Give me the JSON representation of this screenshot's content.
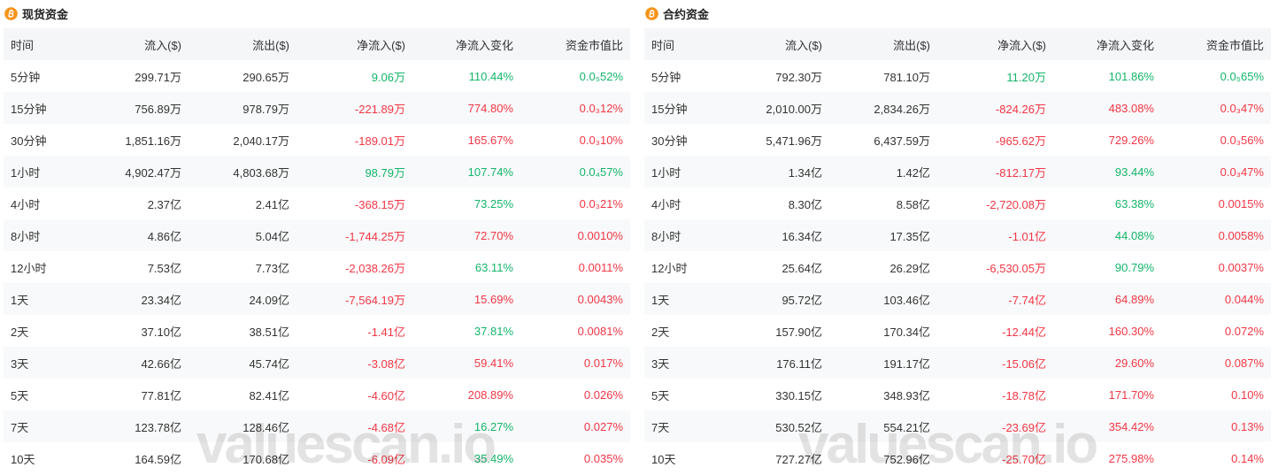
{
  "colors": {
    "green": "#14b56a",
    "red": "#f23645",
    "text": "#333333",
    "title": "#222222",
    "header_bg": "#f5f6f8",
    "stripe_bg": "#f8f9fa",
    "bitcoin": "#f7931a"
  },
  "panels": [
    {
      "title": "现货资金",
      "icon": "bitcoin-icon",
      "watermark": "valuescan.io",
      "columns": [
        "时间",
        "流入($)",
        "流出($)",
        "净流入($)",
        "净流入变化",
        "资金市值比"
      ],
      "rows": [
        {
          "time": "5分钟",
          "inflow": "299.71万",
          "outflow": "290.65万",
          "net": "9.06万",
          "change": "110.44%",
          "ratio": "0.0₅52%",
          "net_color": "green",
          "change_color": "green",
          "ratio_color": "green"
        },
        {
          "time": "15分钟",
          "inflow": "756.89万",
          "outflow": "978.79万",
          "net": "-221.89万",
          "change": "774.80%",
          "ratio": "0.0₃12%",
          "net_color": "red",
          "change_color": "red",
          "ratio_color": "red"
        },
        {
          "time": "30分钟",
          "inflow": "1,851.16万",
          "outflow": "2,040.17万",
          "net": "-189.01万",
          "change": "165.67%",
          "ratio": "0.0₃10%",
          "net_color": "red",
          "change_color": "red",
          "ratio_color": "red"
        },
        {
          "time": "1小时",
          "inflow": "4,902.47万",
          "outflow": "4,803.68万",
          "net": "98.79万",
          "change": "107.74%",
          "ratio": "0.0₄57%",
          "net_color": "green",
          "change_color": "green",
          "ratio_color": "green"
        },
        {
          "time": "4小时",
          "inflow": "2.37亿",
          "outflow": "2.41亿",
          "net": "-368.15万",
          "change": "73.25%",
          "ratio": "0.0₃21%",
          "net_color": "red",
          "change_color": "green",
          "ratio_color": "red"
        },
        {
          "time": "8小时",
          "inflow": "4.86亿",
          "outflow": "5.04亿",
          "net": "-1,744.25万",
          "change": "72.70%",
          "ratio": "0.0010%",
          "net_color": "red",
          "change_color": "red",
          "ratio_color": "red"
        },
        {
          "time": "12小时",
          "inflow": "7.53亿",
          "outflow": "7.73亿",
          "net": "-2,038.26万",
          "change": "63.11%",
          "ratio": "0.0011%",
          "net_color": "red",
          "change_color": "green",
          "ratio_color": "red"
        },
        {
          "time": "1天",
          "inflow": "23.34亿",
          "outflow": "24.09亿",
          "net": "-7,564.19万",
          "change": "15.69%",
          "ratio": "0.0043%",
          "net_color": "red",
          "change_color": "red",
          "ratio_color": "red"
        },
        {
          "time": "2天",
          "inflow": "37.10亿",
          "outflow": "38.51亿",
          "net": "-1.41亿",
          "change": "37.81%",
          "ratio": "0.0081%",
          "net_color": "red",
          "change_color": "green",
          "ratio_color": "red"
        },
        {
          "time": "3天",
          "inflow": "42.66亿",
          "outflow": "45.74亿",
          "net": "-3.08亿",
          "change": "59.41%",
          "ratio": "0.017%",
          "net_color": "red",
          "change_color": "red",
          "ratio_color": "red"
        },
        {
          "time": "5天",
          "inflow": "77.81亿",
          "outflow": "82.41亿",
          "net": "-4.60亿",
          "change": "208.89%",
          "ratio": "0.026%",
          "net_color": "red",
          "change_color": "red",
          "ratio_color": "red"
        },
        {
          "time": "7天",
          "inflow": "123.78亿",
          "outflow": "128.46亿",
          "net": "-4.68亿",
          "change": "16.27%",
          "ratio": "0.027%",
          "net_color": "red",
          "change_color": "green",
          "ratio_color": "red"
        },
        {
          "time": "10天",
          "inflow": "164.59亿",
          "outflow": "170.68亿",
          "net": "-6.09亿",
          "change": "35.49%",
          "ratio": "0.035%",
          "net_color": "red",
          "change_color": "green",
          "ratio_color": "red"
        }
      ]
    },
    {
      "title": "合约资金",
      "icon": "bitcoin-icon",
      "watermark": "valuescan.io",
      "columns": [
        "时间",
        "流入($)",
        "流出($)",
        "净流入($)",
        "净流入变化",
        "资金市值比"
      ],
      "rows": [
        {
          "time": "5分钟",
          "inflow": "792.30万",
          "outflow": "781.10万",
          "net": "11.20万",
          "change": "101.86%",
          "ratio": "0.0₅65%",
          "net_color": "green",
          "change_color": "green",
          "ratio_color": "green"
        },
        {
          "time": "15分钟",
          "inflow": "2,010.00万",
          "outflow": "2,834.26万",
          "net": "-824.26万",
          "change": "483.08%",
          "ratio": "0.0₃47%",
          "net_color": "red",
          "change_color": "red",
          "ratio_color": "red"
        },
        {
          "time": "30分钟",
          "inflow": "5,471.96万",
          "outflow": "6,437.59万",
          "net": "-965.62万",
          "change": "729.26%",
          "ratio": "0.0₃56%",
          "net_color": "red",
          "change_color": "red",
          "ratio_color": "red"
        },
        {
          "time": "1小时",
          "inflow": "1.34亿",
          "outflow": "1.42亿",
          "net": "-812.17万",
          "change": "93.44%",
          "ratio": "0.0₃47%",
          "net_color": "red",
          "change_color": "green",
          "ratio_color": "red"
        },
        {
          "time": "4小时",
          "inflow": "8.30亿",
          "outflow": "8.58亿",
          "net": "-2,720.08万",
          "change": "63.38%",
          "ratio": "0.0015%",
          "net_color": "red",
          "change_color": "green",
          "ratio_color": "red"
        },
        {
          "time": "8小时",
          "inflow": "16.34亿",
          "outflow": "17.35亿",
          "net": "-1.01亿",
          "change": "44.08%",
          "ratio": "0.0058%",
          "net_color": "red",
          "change_color": "green",
          "ratio_color": "red"
        },
        {
          "time": "12小时",
          "inflow": "25.64亿",
          "outflow": "26.29亿",
          "net": "-6,530.05万",
          "change": "90.79%",
          "ratio": "0.0037%",
          "net_color": "red",
          "change_color": "green",
          "ratio_color": "red"
        },
        {
          "time": "1天",
          "inflow": "95.72亿",
          "outflow": "103.46亿",
          "net": "-7.74亿",
          "change": "64.89%",
          "ratio": "0.044%",
          "net_color": "red",
          "change_color": "red",
          "ratio_color": "red"
        },
        {
          "time": "2天",
          "inflow": "157.90亿",
          "outflow": "170.34亿",
          "net": "-12.44亿",
          "change": "160.30%",
          "ratio": "0.072%",
          "net_color": "red",
          "change_color": "red",
          "ratio_color": "red"
        },
        {
          "time": "3天",
          "inflow": "176.11亿",
          "outflow": "191.17亿",
          "net": "-15.06亿",
          "change": "29.60%",
          "ratio": "0.087%",
          "net_color": "red",
          "change_color": "red",
          "ratio_color": "red"
        },
        {
          "time": "5天",
          "inflow": "330.15亿",
          "outflow": "348.93亿",
          "net": "-18.78亿",
          "change": "171.70%",
          "ratio": "0.10%",
          "net_color": "red",
          "change_color": "red",
          "ratio_color": "red"
        },
        {
          "time": "7天",
          "inflow": "530.52亿",
          "outflow": "554.21亿",
          "net": "-23.69亿",
          "change": "354.42%",
          "ratio": "0.13%",
          "net_color": "red",
          "change_color": "red",
          "ratio_color": "red"
        },
        {
          "time": "10天",
          "inflow": "727.27亿",
          "outflow": "752.96亿",
          "net": "-25.70亿",
          "change": "275.98%",
          "ratio": "0.14%",
          "net_color": "red",
          "change_color": "red",
          "ratio_color": "red"
        }
      ]
    }
  ]
}
